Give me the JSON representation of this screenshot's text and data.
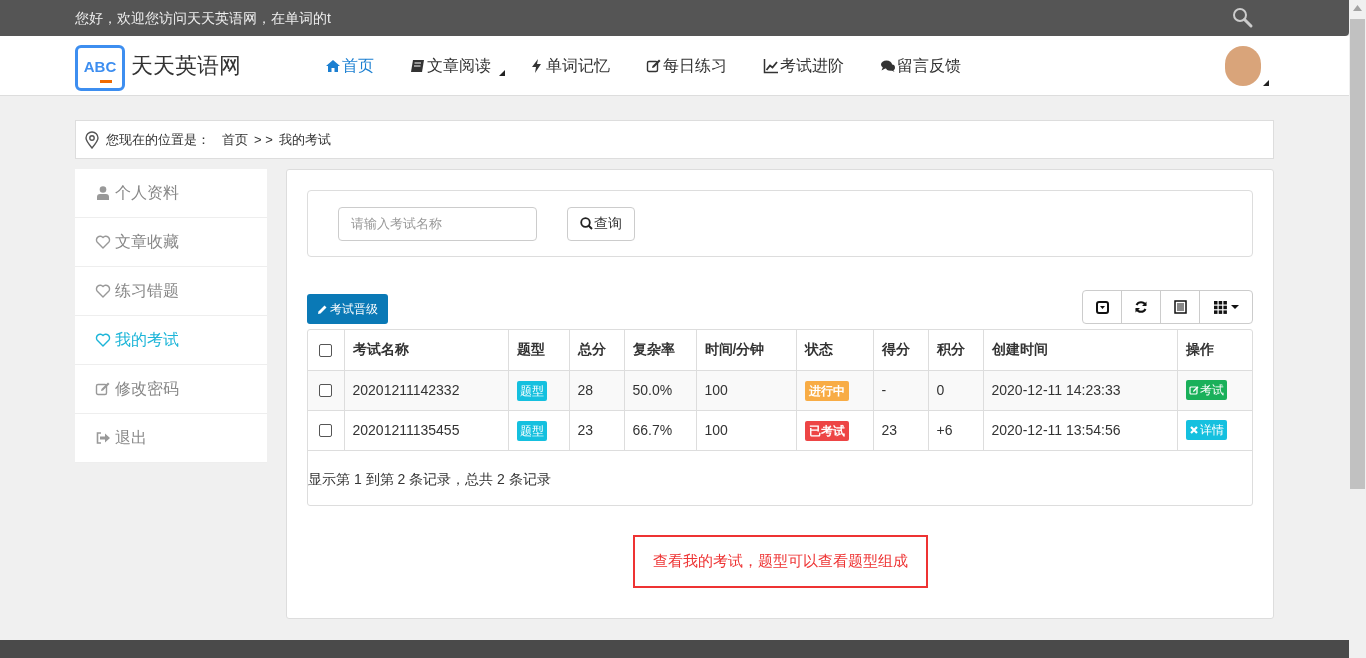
{
  "topbar": {
    "welcome": "您好，欢迎您访问天天英语网，在单词的t"
  },
  "nav": {
    "logo_text": "天天英语网",
    "logo_badge": "ABC",
    "items": [
      {
        "label": "首页",
        "kind": "home",
        "selected": true,
        "dropdown": false
      },
      {
        "label": "文章阅读",
        "kind": "book",
        "selected": false,
        "dropdown": true
      },
      {
        "label": "单词记忆",
        "kind": "bolt",
        "selected": false,
        "dropdown": false
      },
      {
        "label": "每日练习",
        "kind": "edit",
        "selected": false,
        "dropdown": false
      },
      {
        "label": "考试进阶",
        "kind": "chart",
        "selected": false,
        "dropdown": false
      },
      {
        "label": "留言反馈",
        "kind": "comments",
        "selected": false,
        "dropdown": false
      }
    ]
  },
  "breadcrumb": {
    "label": "您现在的位置是：",
    "home": "首页",
    "separator": "> >",
    "current": "我的考试"
  },
  "sidebar": {
    "items": [
      {
        "label": "个人资料",
        "kind": "user",
        "selected": false
      },
      {
        "label": "文章收藏",
        "kind": "heart",
        "selected": false
      },
      {
        "label": "练习错题",
        "kind": "heart",
        "selected": false
      },
      {
        "label": "我的考试",
        "kind": "heart",
        "selected": true
      },
      {
        "label": "修改密码",
        "kind": "edit",
        "selected": false
      },
      {
        "label": "退出",
        "kind": "signout",
        "selected": false
      }
    ]
  },
  "search": {
    "placeholder": "请输入考试名称",
    "button": "查询"
  },
  "upgrade_button": "考试晋级",
  "table": {
    "header_checked": false,
    "columns": [
      "考试名称",
      "题型",
      "总分",
      "复杂率",
      "时间/分钟",
      "状态",
      "得分",
      "积分",
      "创建时间",
      "操作"
    ],
    "rows": [
      {
        "checked": false,
        "name": "20201211142332",
        "type_tag": "题型",
        "total": "28",
        "complexity": "50.0%",
        "time": "100",
        "status": {
          "label": "进行中",
          "kind": "ongoing"
        },
        "score": "-",
        "points": "0",
        "created": "2020-12-11 14:23:33",
        "action": {
          "label": "考试",
          "kind": "exam"
        }
      },
      {
        "checked": false,
        "name": "20201211135455",
        "type_tag": "题型",
        "total": "23",
        "complexity": "66.7%",
        "time": "100",
        "status": {
          "label": "已考试",
          "kind": "done"
        },
        "score": "23",
        "points": "+6",
        "created": "2020-12-11 13:54:56",
        "action": {
          "label": "详情",
          "kind": "detail"
        }
      }
    ]
  },
  "pagination_info": "显示第 1 到第 2 条记录，总共 2 条记录",
  "note": "查看我的考试，题型可以查看题型组成"
}
